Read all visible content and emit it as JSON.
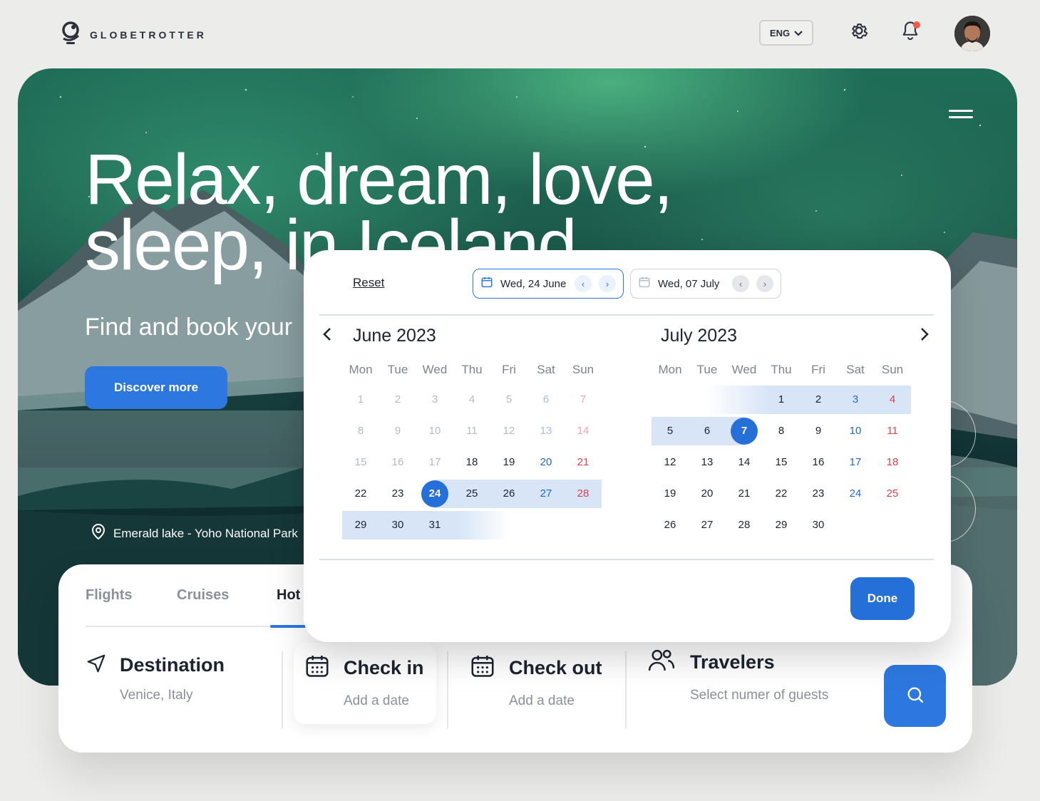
{
  "header": {
    "logo_text": "GLOBETROTTER",
    "language": "ENG",
    "icons": [
      "globe-logo-icon",
      "chevron-down-icon",
      "gear-icon",
      "bell-icon",
      "avatar"
    ]
  },
  "hero": {
    "headline_line1": "Relax, dream, love,",
    "headline_line2": "sleep, in Iceland",
    "subhead": "Find and book your",
    "cta_label": "Discover more",
    "location": "Emerald lake - Yoho National Park"
  },
  "booking": {
    "tabs": [
      {
        "label": "Flights"
      },
      {
        "label": "Cruises"
      },
      {
        "label": "Hot"
      }
    ],
    "fields": {
      "destination": {
        "title": "Destination",
        "value": "Venice, Italy"
      },
      "checkin": {
        "title": "Check in",
        "placeholder": "Add a date"
      },
      "checkout": {
        "title": "Check out",
        "placeholder": "Add a date"
      },
      "travelers": {
        "title": "Travelers",
        "placeholder": "Select numer of guests"
      }
    }
  },
  "calendar": {
    "reset_label": "Reset",
    "start_date": "Wed, 24 June",
    "end_date": "Wed, 07 July",
    "weekdays": [
      "Mon",
      "Tue",
      "Wed",
      "Thu",
      "Fri",
      "Sat",
      "Sun"
    ],
    "done_label": "Done",
    "colors": {
      "accent": "#2570d8",
      "range": "#d7e5f7",
      "weekend_sat": "#1f6ad4",
      "weekend_sun": "#e0424a"
    },
    "months": [
      {
        "title": "June 2023",
        "weeks": [
          [
            1,
            2,
            3,
            4,
            5,
            6,
            7
          ],
          [
            8,
            9,
            10,
            11,
            12,
            13,
            14
          ],
          [
            15,
            16,
            17,
            18,
            19,
            20,
            21
          ],
          [
            22,
            23,
            24,
            25,
            26,
            27,
            28
          ],
          [
            29,
            30,
            31,
            null,
            null,
            null,
            null
          ]
        ],
        "past_until": 17,
        "selected": 24,
        "range_from": 24
      },
      {
        "title": "July 2023",
        "weeks": [
          [
            null,
            null,
            null,
            1,
            2,
            3,
            4
          ],
          [
            5,
            6,
            7,
            8,
            9,
            10,
            11
          ],
          [
            12,
            13,
            14,
            15,
            16,
            17,
            18
          ],
          [
            19,
            20,
            21,
            22,
            23,
            24,
            25
          ],
          [
            26,
            27,
            28,
            29,
            30,
            null,
            null
          ]
        ],
        "past_until": 0,
        "selected": 7,
        "range_to": 7
      }
    ]
  }
}
